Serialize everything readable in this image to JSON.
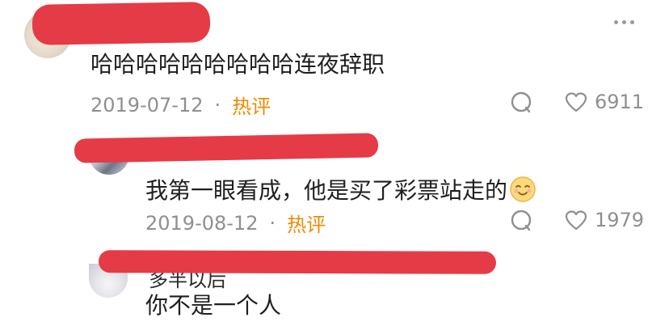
{
  "comments": [
    {
      "content": "哈哈哈哈哈哈哈哈哈连夜辞职",
      "date": "2019-07-12",
      "separator": "·",
      "tag": "热评",
      "likes": "6911"
    },
    {
      "content": "我第一眼看成，他是买了彩票站走的",
      "date": "2019-08-12",
      "separator": "·",
      "tag": "热评",
      "likes": "1979"
    },
    {
      "content": "你不是一个人",
      "name_fragment": "多半以后"
    }
  ],
  "icons": {
    "more": "more-icon",
    "reply": "comment-bubble-icon",
    "like": "heart-icon",
    "emoji": "smiling-face-emoji"
  },
  "colors": {
    "hot_tag": "#f08a00",
    "redaction": "#e53b47",
    "meta_text": "#8f8f8f"
  }
}
